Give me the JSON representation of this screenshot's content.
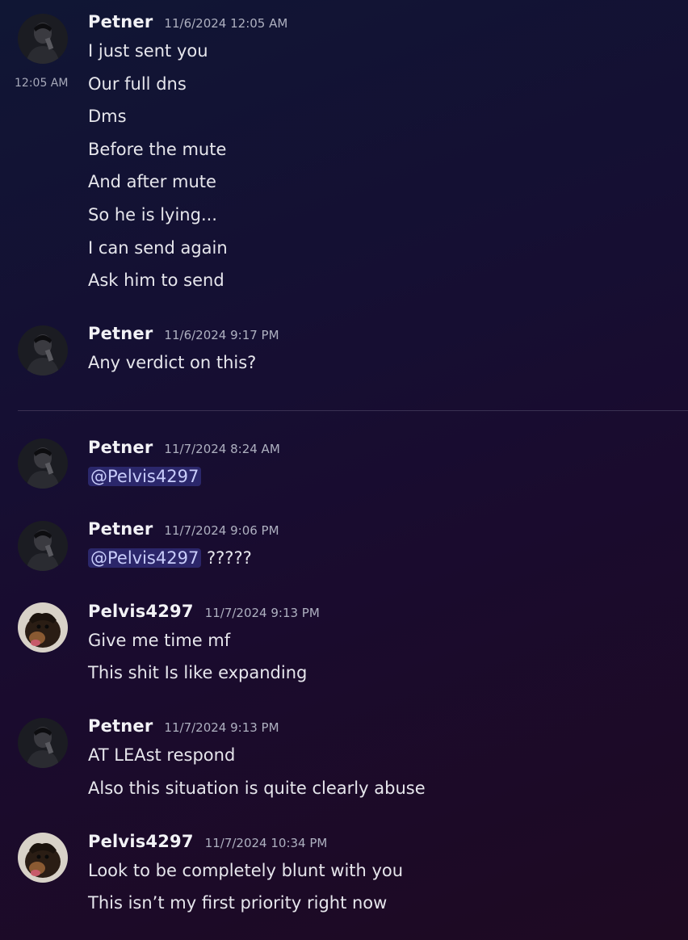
{
  "messages": [
    {
      "author": "Petner",
      "timestamp": "11/6/2024 12:05 AM",
      "avatar": "petner-avatar",
      "lines": [
        "I just sent you",
        "Our full dns",
        "Dms",
        "Before the mute",
        "And after mute",
        "So he is lying...",
        "I can send again",
        "Ask him to send"
      ],
      "hover_time": "12:05 AM"
    },
    {
      "author": "Petner",
      "timestamp": "11/6/2024 9:17 PM",
      "avatar": "petner-avatar",
      "lines": [
        "Any verdict on this?"
      ]
    },
    {
      "author": "Petner",
      "timestamp": "11/7/2024 8:24 AM",
      "avatar": "petner-avatar",
      "mention": "@Pelvis4297",
      "lines": []
    },
    {
      "author": "Petner",
      "timestamp": "11/7/2024 9:06 PM",
      "avatar": "petner-avatar",
      "mention": "@Pelvis4297",
      "after_mention": " ?????",
      "lines": []
    },
    {
      "author": "Pelvis4297",
      "timestamp": "11/7/2024 9:13 PM",
      "avatar": "pelvis-avatar",
      "lines": [
        "Give me time mf",
        "This shit Is like expanding"
      ]
    },
    {
      "author": "Petner",
      "timestamp": "11/7/2024 9:13 PM",
      "avatar": "petner-avatar",
      "lines": [
        "AT LEAst respond",
        "Also this situation is quite clearly abuse"
      ]
    },
    {
      "author": "Pelvis4297",
      "timestamp": "11/7/2024 10:34 PM",
      "avatar": "pelvis-avatar",
      "lines": [
        "Look to be completely blunt with you",
        "This isn’t my first priority right now"
      ]
    }
  ],
  "colors": {
    "mention_bg": "#3a3f7a",
    "mention_text": "#c9cdfb",
    "author": "#f2f2f6",
    "timestamp": "#aeb0c0"
  }
}
